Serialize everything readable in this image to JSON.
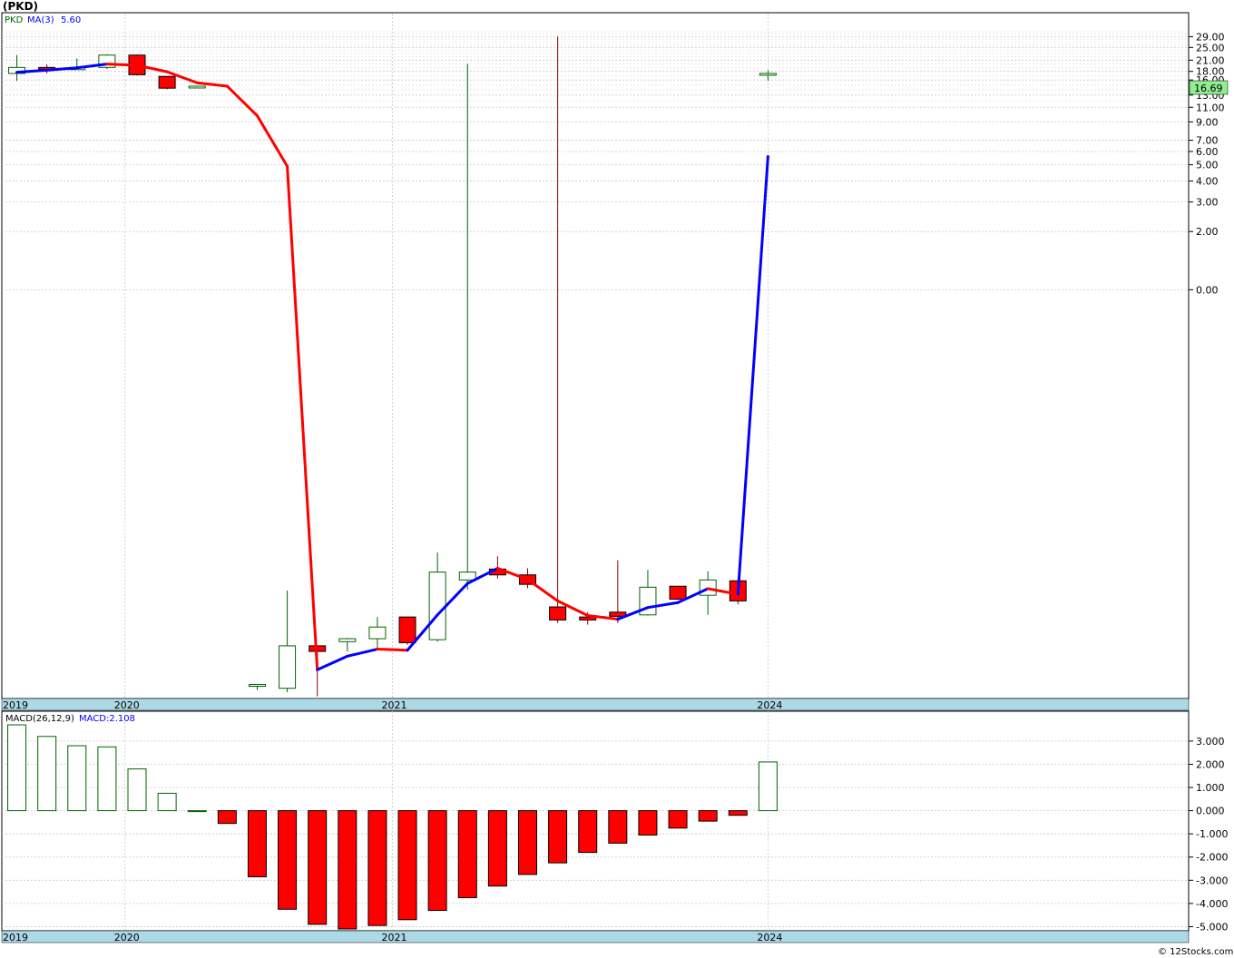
{
  "title": "(PKD)",
  "colors": {
    "up": "#006400",
    "down": "#ff0000",
    "down_wick": "#8b0000",
    "ma_up": "#0000ff",
    "ma_down": "#ff0000",
    "axis_band": "#add8e6",
    "grid": "#c8c8c8",
    "price_label_bg": "#90ee90"
  },
  "price_panel": {
    "legend": {
      "symbol": "PKD",
      "ma_label": "MA(3)",
      "ma_value": "5.60"
    },
    "last_price_label": "16.69",
    "y_ticks": [
      "29.00",
      "25.00",
      "21.00",
      "18.00",
      "16.00",
      "13.00",
      "11.00",
      "9.00",
      "7.00",
      "6.00",
      "5.00",
      "4.00",
      "3.00",
      "2.00",
      "0.00"
    ],
    "year_labels": [
      "2019",
      "2020",
      "2021",
      "2024"
    ]
  },
  "macd_panel": {
    "legend": {
      "name": "MACD(26,12,9)",
      "value_label": "MACD:2.108"
    },
    "y_ticks": [
      "3.000",
      "2.000",
      "1.000",
      "0.000",
      "-1.000",
      "-2.000",
      "-3.000",
      "-4.000",
      "-5.000"
    ],
    "year_labels": [
      "2019",
      "2020",
      "2021",
      "2024"
    ]
  },
  "credit": "© 12Stocks.com",
  "chart_data": [
    {
      "type": "candlestick",
      "title": "(PKD)",
      "scale": "log",
      "series": [
        {
          "name": "PKD",
          "type": "ohlc"
        },
        {
          "name": "MA(3)",
          "type": "line"
        }
      ],
      "ohlc": [
        {
          "x": 1,
          "open": 17.5,
          "high": 22.5,
          "low": 15.8,
          "close": 19.0
        },
        {
          "x": 2,
          "open": 19.0,
          "high": 19.8,
          "low": 17.5,
          "close": 18.8
        },
        {
          "x": 3,
          "open": 18.8,
          "high": 21.5,
          "low": 18.5,
          "close": 18.9
        },
        {
          "x": 4,
          "open": 19.0,
          "high": 22.8,
          "low": 18.6,
          "close": 22.5
        },
        {
          "x": 5,
          "open": 22.5,
          "high": 22.7,
          "low": 17.0,
          "close": 17.2
        },
        {
          "x": 6,
          "open": 16.8,
          "high": 16.8,
          "low": 14.1,
          "close": 14.3
        },
        {
          "x": 7,
          "open": 14.7,
          "high": 14.8,
          "low": 14.6,
          "close": 14.7
        },
        {
          "x": 9,
          "open": 0.004,
          "high": 0.004,
          "low": 0.0037,
          "close": 0.004
        },
        {
          "x": 10,
          "open": 0.0038,
          "high": 0.0145,
          "low": 0.0036,
          "close": 0.0068
        },
        {
          "x": 11,
          "open": 0.0068,
          "high": 0.0068,
          "low": 0.0034,
          "close": 0.0063
        },
        {
          "x": 12,
          "open": 0.0072,
          "high": 0.0076,
          "low": 0.0063,
          "close": 0.0075
        },
        {
          "x": 13,
          "open": 0.0075,
          "high": 0.0101,
          "low": 0.0064,
          "close": 0.0088
        },
        {
          "x": 14,
          "open": 0.0101,
          "high": 0.0101,
          "low": 0.0069,
          "close": 0.0071
        },
        {
          "x": 15,
          "open": 0.0074,
          "high": 0.0245,
          "low": 0.0072,
          "close": 0.0187
        },
        {
          "x": 16,
          "open": 0.0168,
          "high": 20.0,
          "low": 0.0147,
          "close": 0.0187
        },
        {
          "x": 17,
          "open": 0.0195,
          "high": 0.0232,
          "low": 0.0171,
          "close": 0.018
        },
        {
          "x": 18,
          "open": 0.018,
          "high": 0.0197,
          "low": 0.015,
          "close": 0.0158
        },
        {
          "x": 19,
          "open": 0.0116,
          "high": 29.0,
          "low": 0.0093,
          "close": 0.0097
        },
        {
          "x": 20,
          "open": 0.0101,
          "high": 0.0108,
          "low": 0.0091,
          "close": 0.0097
        },
        {
          "x": 21,
          "open": 0.0108,
          "high": 0.022,
          "low": 0.0093,
          "close": 0.0102
        },
        {
          "x": 22,
          "open": 0.0104,
          "high": 0.0193,
          "low": 0.0103,
          "close": 0.0152
        },
        {
          "x": 23,
          "open": 0.0154,
          "high": 0.0154,
          "low": 0.0128,
          "close": 0.0129
        },
        {
          "x": 24,
          "open": 0.0136,
          "high": 0.0189,
          "low": 0.0104,
          "close": 0.0168
        },
        {
          "x": 25,
          "open": 0.0166,
          "high": 0.0166,
          "low": 0.012,
          "close": 0.0126
        },
        {
          "x": 26,
          "open": 17.5,
          "high": 18.3,
          "low": 15.8,
          "close": 17.5
        }
      ],
      "ma": [
        {
          "x": 1,
          "y": 17.8
        },
        {
          "x": 2,
          "y": 18.3
        },
        {
          "x": 3,
          "y": 18.9
        },
        {
          "x": 4,
          "y": 19.9
        },
        {
          "x": 5,
          "y": 19.6
        },
        {
          "x": 6,
          "y": 17.9
        },
        {
          "x": 7,
          "y": 15.4
        },
        {
          "x": 8,
          "y": 14.7
        },
        {
          "x": 9,
          "y": 9.8
        },
        {
          "x": 10,
          "y": 4.9
        },
        {
          "x": 11,
          "y": 0.0049
        },
        {
          "x": 12,
          "y": 0.0059
        },
        {
          "x": 13,
          "y": 0.0065
        },
        {
          "x": 14,
          "y": 0.0064
        },
        {
          "x": 15,
          "y": 0.0104
        },
        {
          "x": 16,
          "y": 0.016
        },
        {
          "x": 17,
          "y": 0.0197
        },
        {
          "x": 18,
          "y": 0.0169
        },
        {
          "x": 19,
          "y": 0.0126
        },
        {
          "x": 20,
          "y": 0.0103
        },
        {
          "x": 21,
          "y": 0.0098
        },
        {
          "x": 22,
          "y": 0.0115
        },
        {
          "x": 23,
          "y": 0.0123
        },
        {
          "x": 24,
          "y": 0.0149
        },
        {
          "x": 25,
          "y": 0.0138
        },
        {
          "x": 26,
          "y": 5.6
        }
      ],
      "y_tick_values": [
        29,
        25,
        21,
        18,
        16,
        13,
        11,
        9,
        7,
        6,
        5,
        4,
        3,
        2,
        0.9
      ],
      "ylim": [
        0.0033,
        33
      ],
      "x_range": [
        0.5,
        40
      ],
      "year_positions": [
        {
          "label": "2019",
          "x": 0.55
        },
        {
          "label": "2020",
          "x": 4.6
        },
        {
          "label": "2021",
          "x": 13.5
        },
        {
          "label": "2024",
          "x": 26.0
        }
      ],
      "grid": true
    },
    {
      "type": "bar",
      "title": "MACD(26,12,9)",
      "series": [
        {
          "name": "MACD(26,12,9)"
        }
      ],
      "x": [
        1,
        2,
        3,
        4,
        5,
        6,
        7,
        8,
        9,
        10,
        11,
        12,
        13,
        14,
        15,
        16,
        17,
        18,
        19,
        20,
        21,
        22,
        23,
        24,
        25,
        26
      ],
      "values": [
        3.7,
        3.2,
        2.8,
        2.75,
        1.8,
        0.75,
        0.0,
        -0.55,
        -2.85,
        -4.25,
        -4.9,
        -5.1,
        -4.95,
        -4.7,
        -4.3,
        -3.75,
        -3.25,
        -2.75,
        -2.25,
        -1.8,
        -1.4,
        -1.05,
        -0.75,
        -0.45,
        -0.2,
        2.1
      ],
      "ylim": [
        -5.1,
        3.7
      ],
      "x_range": [
        0.5,
        40
      ],
      "grid": true
    }
  ]
}
